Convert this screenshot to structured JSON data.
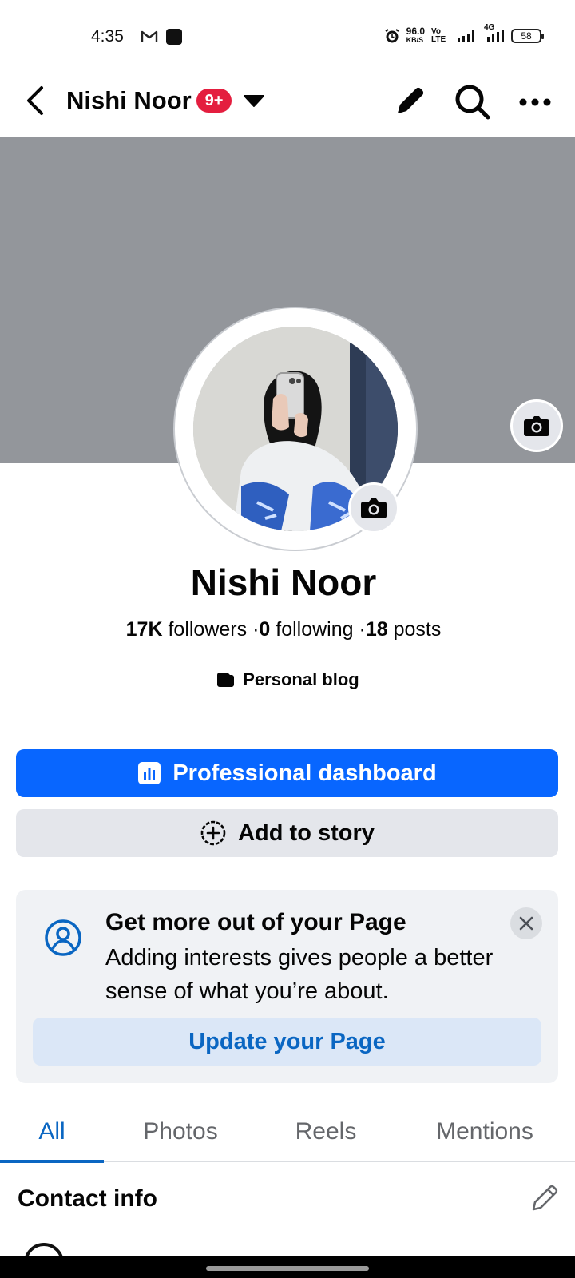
{
  "status_bar": {
    "time": "4:35",
    "net_speed_value": "96.0",
    "net_speed_unit": "KB/S",
    "volte": "Vo LTE",
    "network": "4G",
    "battery": "58"
  },
  "header": {
    "title": "Nishi Noor",
    "badge": "9+"
  },
  "profile": {
    "name": "Nishi Noor",
    "followers_count": "17K",
    "followers_label": "followers",
    "following_count": "0",
    "following_label": "following",
    "posts_count": "18",
    "posts_label": "posts",
    "separator": "·",
    "category": "Personal blog"
  },
  "actions": {
    "primary_label": "Professional dashboard",
    "secondary_label": "Add to story"
  },
  "suggestion_card": {
    "title": "Get more out of your Page",
    "body": "Adding interests gives people a better sense of what you’re about.",
    "cta": "Update your Page"
  },
  "tabs": [
    {
      "label": "All",
      "active": true
    },
    {
      "label": "Photos",
      "active": false
    },
    {
      "label": "Reels",
      "active": false
    },
    {
      "label": "Mentions",
      "active": false
    }
  ],
  "contact": {
    "title": "Contact info"
  },
  "colors": {
    "primary": "#0866ff",
    "link": "#0a66c2",
    "badge": "#e41e3f",
    "cover": "#93969b"
  }
}
